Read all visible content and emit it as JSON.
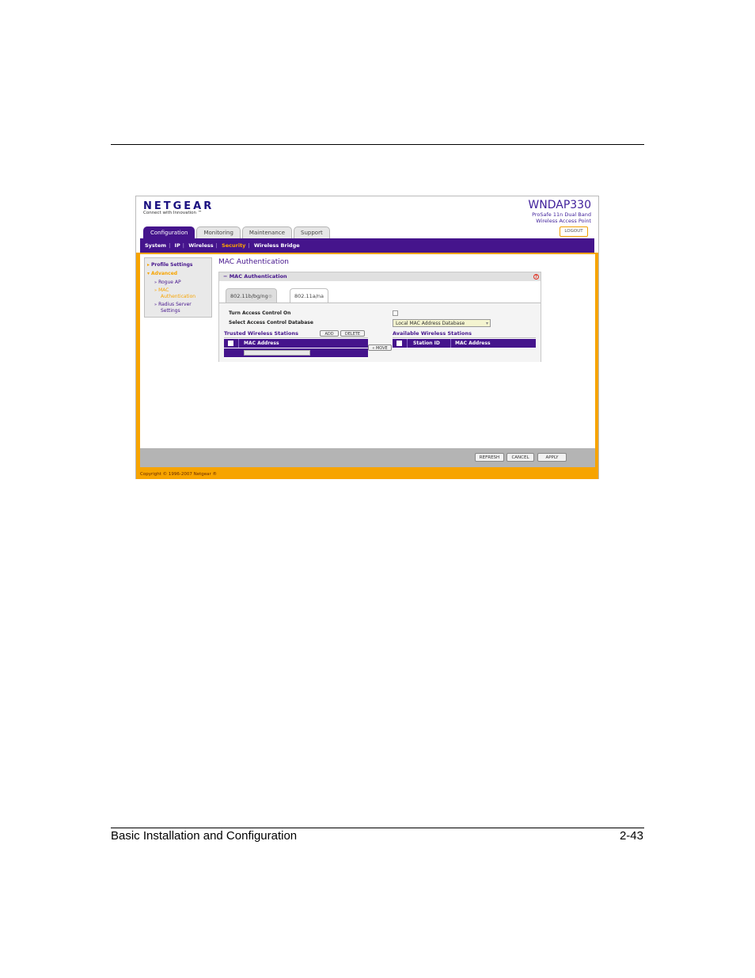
{
  "doc": {
    "footer_left": "Basic Installation and Configuration",
    "footer_right": "2-43"
  },
  "header": {
    "logo": "NETGEAR",
    "tagline": "Connect with Innovation ™",
    "model": "WNDAP330",
    "description_line1": "ProSafe 11n Dual Band",
    "description_line2": "Wireless Access Point",
    "logout_label": "LOGOUT"
  },
  "main_tabs": [
    {
      "label": "Configuration",
      "active": true
    },
    {
      "label": "Monitoring"
    },
    {
      "label": "Maintenance"
    },
    {
      "label": "Support"
    }
  ],
  "sub_nav": [
    {
      "label": "System"
    },
    {
      "label": "IP"
    },
    {
      "label": "Wireless"
    },
    {
      "label": "Security",
      "active": true
    },
    {
      "label": "Wireless Bridge"
    }
  ],
  "sidebar": {
    "profile_settings": "Profile Settings",
    "advanced": "Advanced",
    "items": [
      {
        "label": "Rogue AP"
      },
      {
        "label_line1": "MAC",
        "label_line2": "Authentication",
        "active": true
      },
      {
        "label_line1": "Radius Server",
        "label_line2": "Settings"
      }
    ]
  },
  "page": {
    "title": "MAC Authentication",
    "panel_title": "MAC Authentication",
    "help_icon": "?",
    "tabs": [
      {
        "label": "802.11b/bg/ng",
        "active": false
      },
      {
        "label": "802.11a/na",
        "active": true
      }
    ],
    "turn_access_control_label": "Turn Access Control On",
    "turn_access_control_checked": false,
    "select_db_label": "Select Access Control Database",
    "select_db_value": "Local MAC Address Database",
    "trusted_title": "Trusted Wireless Stations",
    "add_label": "ADD",
    "delete_label": "DELETE",
    "move_label": "« MOVE",
    "trusted_columns": [
      "MAC Address"
    ],
    "available_title": "Available Wireless Stations",
    "available_columns": [
      "Station ID",
      "MAC Address"
    ]
  },
  "buttons": {
    "refresh": "REFRESH",
    "cancel": "CANCEL",
    "apply": "APPLY"
  },
  "copyright": "Copyright © 1996-2007 Netgear ®",
  "colors": {
    "brand_purple": "#45148c",
    "accent_orange": "#f7a400"
  }
}
